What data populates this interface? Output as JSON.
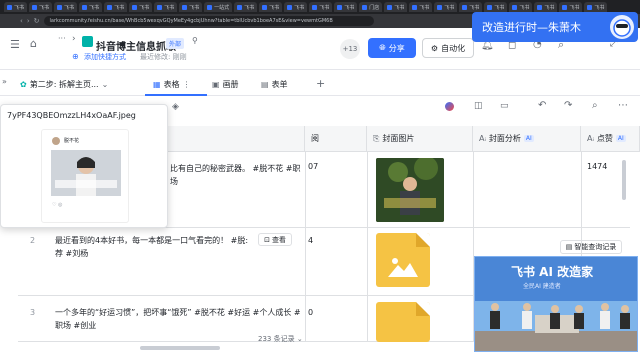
{
  "browser": {
    "tabs": [
      "飞书",
      "飞书",
      "飞书",
      "飞书",
      "飞书",
      "飞书",
      "飞书",
      "飞书",
      "一站式",
      "飞书",
      "飞书",
      "飞书",
      "飞书",
      "飞书",
      "门店",
      "飞书",
      "飞书",
      "飞书",
      "飞书",
      "飞书",
      "飞书",
      "飞书",
      "飞书",
      "飞书"
    ],
    "url": "larkcommunity.feishu.cn/base/WhBcb5wexqvGQyMeEy4gcbjUhnw?table=tblUcbvb1boeA7sE&view=vewmtGM6B"
  },
  "banner": {
    "text": "改造进行时—朱萧木"
  },
  "header": {
    "title": "抖音博主信息抓取",
    "external_tag": "外部",
    "shortcut_label": "添加快捷方式",
    "last_edit": "最近修改: 刚刚",
    "collaborators": "+13",
    "share_label": "分享",
    "automation_label": "自动化"
  },
  "views": {
    "step_label": "第二步: 拆解主页...",
    "tabs": [
      {
        "label": "表格",
        "icon": "table-icon"
      },
      {
        "label": "画册",
        "icon": "gallery-icon"
      },
      {
        "label": "表单",
        "icon": "form-icon"
      }
    ]
  },
  "columns": [
    {
      "label": "阅",
      "ai": false
    },
    {
      "label": "封面图片",
      "ai": false
    },
    {
      "label": "封面分析",
      "ai": true
    },
    {
      "label": "点赞",
      "ai": true
    }
  ],
  "ai_badge": "AI",
  "rows": [
    {
      "num": "1",
      "text": "比有自己的秘密武器。 #脱不花 #职场",
      "views": "07",
      "likes": "1474"
    },
    {
      "num": "2",
      "text": "最近看到的4本好书，每一本都是一口气看完的！ #脱:",
      "text2": "荐 #刘杨",
      "views": "4",
      "likes": ""
    },
    {
      "num": "3",
      "text": "一个多年的“好运习惯”，把坏事“饿死” #脱不花 #好运 #个人成长 #",
      "text2": "职场 #创业",
      "views": "0",
      "likes": ""
    }
  ],
  "view_button": "查看",
  "smart_query": "智能查询记录",
  "record_count": "233 条记录",
  "popup": {
    "filename": "7yPF43QBEOmzzLH4xOaAF.jpeg",
    "author": "脱不花"
  },
  "video": {
    "title": "飞书 AI 改造家",
    "subtitle": "全民AI 建造者"
  },
  "colors": {
    "accent": "#3370ff",
    "banner": "#3371f2"
  }
}
